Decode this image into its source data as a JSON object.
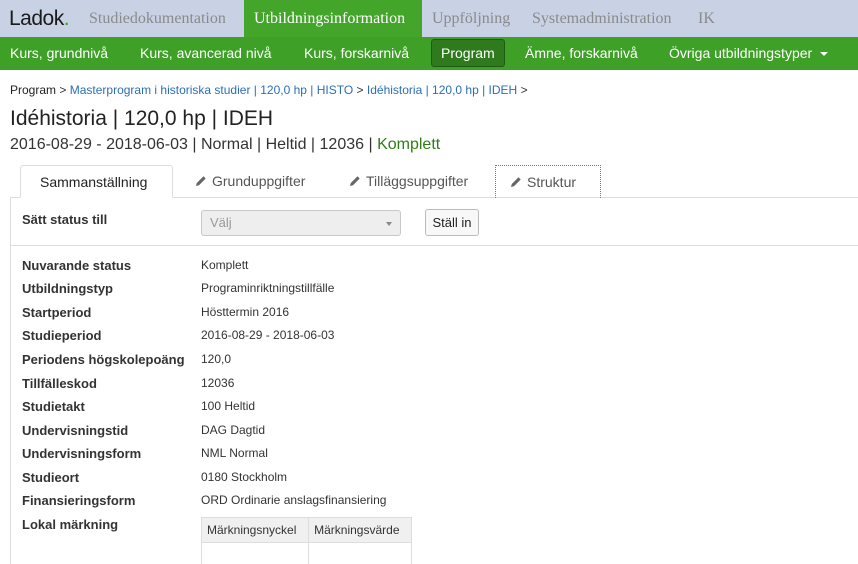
{
  "app": {
    "logo_text": "Ladok",
    "logo_dot": "."
  },
  "topnav": {
    "items": [
      {
        "label": "Studiedokumentation"
      },
      {
        "label": "Utbildningsinformation"
      },
      {
        "label": "Uppföljning"
      },
      {
        "label": "Systemadministration"
      },
      {
        "label": "IK"
      }
    ],
    "active": "Utbildningsinformation"
  },
  "subnav": {
    "items": [
      {
        "label": "Kurs, grundnivå"
      },
      {
        "label": "Kurs, avancerad nivå"
      },
      {
        "label": "Kurs, forskarnivå"
      },
      {
        "label": "Program"
      },
      {
        "label": "Ämne, forskarnivå"
      },
      {
        "label": "Övriga utbildningstyper"
      }
    ],
    "active": "Program"
  },
  "breadcrumb": {
    "root": "Program",
    "sep": ">",
    "links": [
      "Masterprogram i historiska studier | 120,0 hp | HISTO",
      "Idéhistoria | 120,0 hp | IDEH"
    ]
  },
  "page": {
    "title": "Idéhistoria | 120,0 hp | IDEH",
    "subtitle_main": "2016-08-29 - 2018-06-03 | Normal | Heltid | 12036 | ",
    "subtitle_status": "Komplett"
  },
  "tabs": [
    {
      "label": "Sammanställning",
      "active": true
    },
    {
      "label": "Grunduppgifter"
    },
    {
      "label": "Tilläggsuppgifter"
    },
    {
      "label": "Struktur"
    }
  ],
  "status_setter": {
    "label": "Sätt status till",
    "placeholder": "Välj",
    "button": "Ställ in"
  },
  "details": [
    {
      "label": "Nuvarande status",
      "value": "Komplett"
    },
    {
      "label": "Utbildningstyp",
      "value": "Programinriktningstillfälle"
    },
    {
      "label": "Startperiod",
      "value": "Hösttermin 2016"
    },
    {
      "label": "Studieperiod",
      "value": "2016-08-29 - 2018-06-03"
    },
    {
      "label": "Periodens högskolepoäng",
      "value": "120,0"
    },
    {
      "label": "Tillfälleskod",
      "value": "12036"
    },
    {
      "label": "Studietakt",
      "value": "100 Heltid"
    },
    {
      "label": "Undervisningstid",
      "value": "DAG Dagtid"
    },
    {
      "label": "Undervisningsform",
      "value": "NML Normal"
    },
    {
      "label": "Studieort",
      "value": "0180 Stockholm"
    },
    {
      "label": "Finansieringsform",
      "value": "ORD Ordinarie anslagsfinansiering"
    },
    {
      "label": "Lokal märkning",
      "value": ""
    }
  ],
  "marking_table": {
    "headers": [
      "Märkningsnyckel",
      "Märkningsvärde"
    ]
  },
  "colors": {
    "brand_green": "#3ea027",
    "topbar": "#c9d2e4",
    "status_green": "#2f7d15",
    "link": "#2a6fb5"
  }
}
